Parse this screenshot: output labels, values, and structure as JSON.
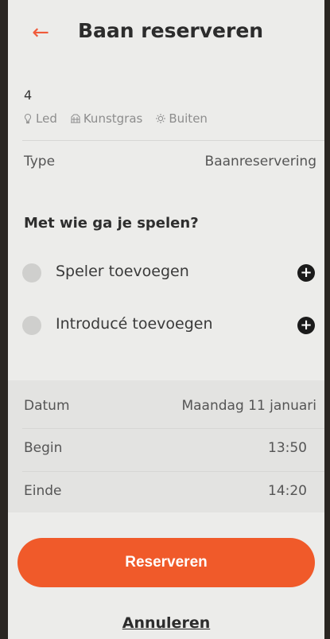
{
  "header": {
    "title": "Baan reserveren",
    "back_icon": "arrow-left-icon"
  },
  "court": {
    "number": "4",
    "features": [
      {
        "icon": "bulb-icon",
        "label": "Led"
      },
      {
        "icon": "turf-icon",
        "label": "Kunstgras"
      },
      {
        "icon": "sun-icon",
        "label": "Buiten"
      }
    ]
  },
  "type_row": {
    "label": "Type",
    "value": "Baanreservering"
  },
  "players": {
    "title": "Met wie ga je spelen?",
    "items": [
      {
        "label": "Speler toevoegen"
      },
      {
        "label": "Introducé toevoegen"
      }
    ]
  },
  "schedule": {
    "date": {
      "label": "Datum",
      "value": "Maandag 11 januari"
    },
    "start": {
      "label": "Begin",
      "value": "13:50"
    },
    "end": {
      "label": "Einde",
      "value": "14:20"
    }
  },
  "actions": {
    "reserve": "Reserveren",
    "cancel": "Annuleren"
  },
  "colors": {
    "accent": "#f05a2a",
    "background": "#ececea"
  }
}
